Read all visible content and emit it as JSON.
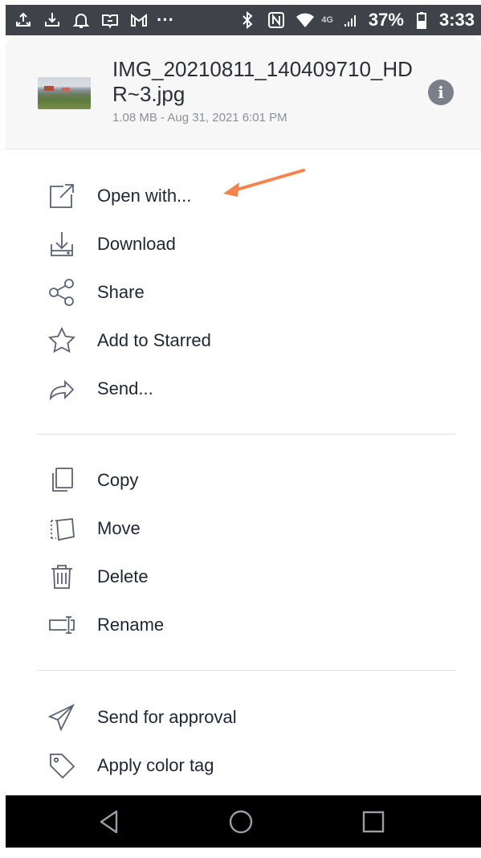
{
  "status_bar": {
    "overflow": "···",
    "network": "4G",
    "battery_percent": "37%",
    "time": "3:33",
    "icons": [
      "upload-icon",
      "download-icon",
      "notification-bell-icon",
      "amazon-icon",
      "gmail-icon",
      "bluetooth-icon",
      "nfc-icon",
      "wifi-icon",
      "signal-icon",
      "battery-icon"
    ]
  },
  "file": {
    "name": "IMG_20210811_140409710_HDR~3.jpg",
    "meta": "1.08 MB - Aug 31, 2021 6:01 PM"
  },
  "menu": {
    "group1": [
      {
        "label": "Open with...",
        "icon": "open-external-icon"
      },
      {
        "label": "Download",
        "icon": "download-icon"
      },
      {
        "label": "Share",
        "icon": "share-icon"
      },
      {
        "label": "Add to Starred",
        "icon": "star-icon"
      },
      {
        "label": "Send...",
        "icon": "send-arrow-icon"
      }
    ],
    "group2": [
      {
        "label": "Copy",
        "icon": "copy-icon"
      },
      {
        "label": "Move",
        "icon": "move-icon"
      },
      {
        "label": "Delete",
        "icon": "trash-icon"
      },
      {
        "label": "Rename",
        "icon": "rename-icon"
      }
    ],
    "group3": [
      {
        "label": "Send for approval",
        "icon": "paper-plane-icon"
      },
      {
        "label": "Apply color tag",
        "icon": "tag-icon"
      }
    ]
  },
  "colors": {
    "annotation_arrow": "#f2844c",
    "text": "#1e2633",
    "icon_stroke": "#5a6170",
    "status_bar": "#3f4249",
    "nav_bar": "#000000"
  },
  "nav_bar": [
    "back-icon",
    "home-icon",
    "recents-icon"
  ]
}
